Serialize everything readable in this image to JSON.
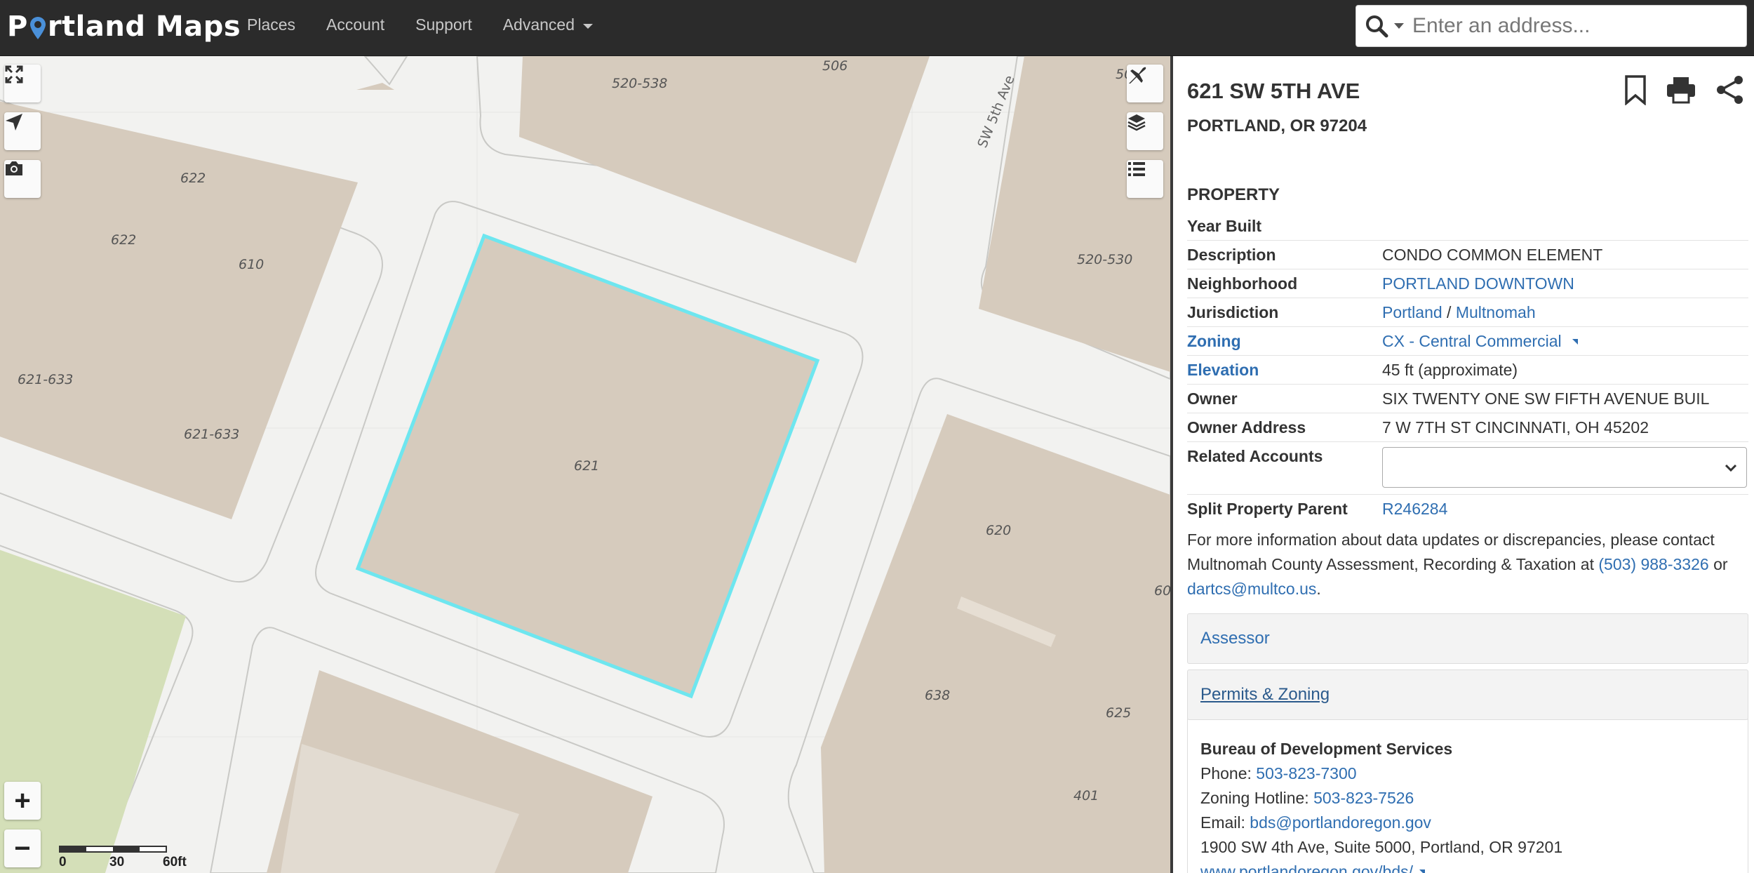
{
  "header": {
    "logo_prefix": "P",
    "logo_suffix": "rtland Maps",
    "nav": [
      {
        "label": "Places"
      },
      {
        "label": "Account"
      },
      {
        "label": "Support"
      },
      {
        "label": "Advanced"
      }
    ],
    "search_placeholder": "Enter an address..."
  },
  "map": {
    "street_label": "SW 5th Ave",
    "lot_labels": [
      "520-538",
      "506",
      "50",
      "622",
      "622",
      "610",
      "520-530",
      "621-633",
      "621-633",
      "621",
      "620",
      "60",
      "638",
      "625",
      "401"
    ],
    "scale": {
      "labels": [
        "0",
        "30",
        "60ft"
      ]
    },
    "controls": {
      "zoom_in": "+",
      "zoom_out": "−"
    },
    "colors": {
      "selected_outline": "#6ee6ef",
      "building": "#d6cbbd",
      "park": "#d4dfb8"
    }
  },
  "panel": {
    "address_line1": "621 SW 5TH AVE",
    "address_line2": "PORTLAND, OR 97204",
    "section_title": "PROPERTY",
    "rows": {
      "year_built": {
        "k": "Year Built",
        "v": ""
      },
      "description": {
        "k": "Description",
        "v": "CONDO COMMON ELEMENT"
      },
      "neighborhood": {
        "k": "Neighborhood",
        "v": "PORTLAND DOWNTOWN"
      },
      "jurisdiction": {
        "k": "Jurisdiction",
        "v1": "Portland",
        "sep": " / ",
        "v2": "Multnomah"
      },
      "zoning": {
        "k": "Zoning",
        "v": "CX - Central Commercial"
      },
      "elevation": {
        "k": "Elevation",
        "v": "45 ft (approximate)"
      },
      "owner": {
        "k": "Owner",
        "v": "SIX TWENTY ONE SW FIFTH AVENUE BUIL"
      },
      "owner_address": {
        "k": "Owner Address",
        "v": "7 W 7TH ST CINCINNATI, OH 45202"
      },
      "related_accounts": {
        "k": "Related Accounts",
        "v": ""
      },
      "split_parent": {
        "k": "Split Property Parent",
        "v": "R246284"
      }
    },
    "note": {
      "text1": "For more information about data updates or discrepancies, please contact Multnomah County Assessment, Recording & Taxation at ",
      "phone": "(503) 988-3326",
      "text2": " or ",
      "email": "dartcs@multco.us",
      "text3": "."
    },
    "accordions": {
      "assessor": "Assessor",
      "permits": "Permits & Zoning"
    },
    "bds": {
      "title": "Bureau of Development Services",
      "phone_label": "Phone: ",
      "phone": "503-823-7300",
      "hotline_label": "Zoning Hotline: ",
      "hotline": "503-823-7526",
      "email_label": "Email: ",
      "email": "bds@portlandoregon.gov",
      "address": "1900 SW 4th Ave, Suite 5000, Portland, OR 97201",
      "url": "www.portlandoregon.gov/bds/"
    }
  }
}
